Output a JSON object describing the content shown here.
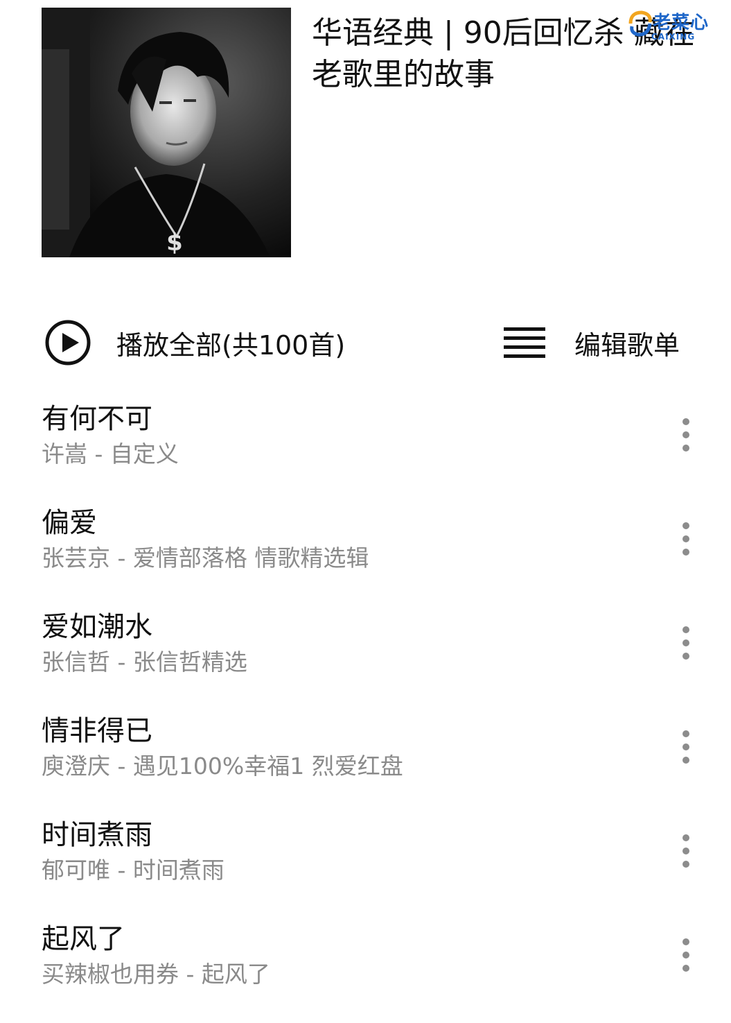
{
  "playlist": {
    "title": "华语经典 | 90后回忆杀 藏在老歌里的故事",
    "cover_alt": "album cover"
  },
  "watermark": {
    "brand": "老菜心",
    "brand_sub": "CAIXING"
  },
  "actions": {
    "play_all_label": "播放全部(共100首)",
    "edit_label": "编辑歌单",
    "play_icon": "play-circle-icon",
    "menu_icon": "list-menu-icon"
  },
  "songs": [
    {
      "title": "有何不可",
      "subtitle": "许嵩 - 自定义"
    },
    {
      "title": "偏爱",
      "subtitle": "张芸京 - 爱情部落格 情歌精选辑"
    },
    {
      "title": "爱如潮水",
      "subtitle": "张信哲 - 张信哲精选"
    },
    {
      "title": "情非得已",
      "subtitle": "庾澄庆 - 遇见100%幸福1 烈爱红盘"
    },
    {
      "title": "时间煮雨",
      "subtitle": "郁可唯 - 时间煮雨"
    },
    {
      "title": "起风了",
      "subtitle": "买辣椒也用券 - 起风了"
    }
  ],
  "colors": {
    "primary_text": "#111111",
    "secondary_text": "#8a8a8a",
    "icon_gray": "#8c8c8c",
    "watermark_blue": "#1f67c9"
  }
}
